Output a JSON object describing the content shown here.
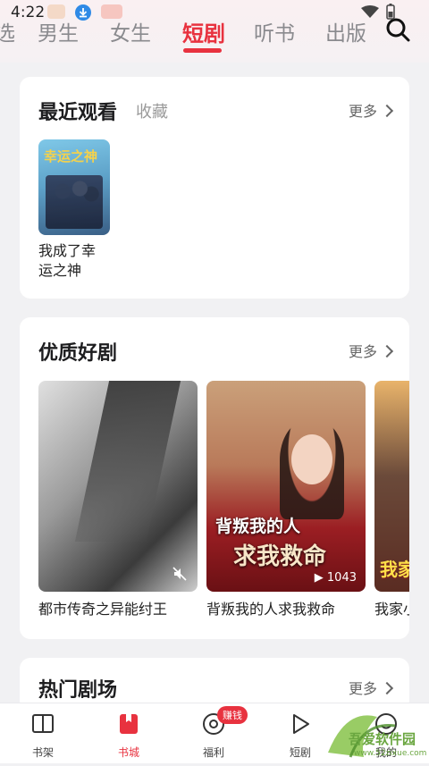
{
  "status_bar": {
    "time": "4:22"
  },
  "tabs": [
    {
      "label": "选"
    },
    {
      "label": "男生"
    },
    {
      "label": "女生"
    },
    {
      "label": "短剧",
      "active": true
    },
    {
      "label": "听书"
    },
    {
      "label": "出版"
    }
  ],
  "recent": {
    "title": "最近观看",
    "subtitle": "收藏",
    "more": "更多",
    "items": [
      {
        "title": "我成了幸运之神",
        "line1": "我成了幸",
        "line2": "运之神",
        "poster_text": "幸运之神"
      }
    ]
  },
  "quality": {
    "title": "优质好剧",
    "more": "更多",
    "items": [
      {
        "title": "都市传奇之异能纣王"
      },
      {
        "title": "背叛我的人求我救命",
        "overlay1": "背叛我的人",
        "overlay2": "求我救命",
        "play_count": "1043"
      },
      {
        "title": "我家小",
        "overlay": "我家"
      }
    ]
  },
  "theater": {
    "title": "热门剧场",
    "more": "更多"
  },
  "bottom_nav": [
    {
      "label": "书架",
      "icon": "book-open-icon"
    },
    {
      "label": "书城",
      "icon": "bookmark-icon",
      "active": true
    },
    {
      "label": "福利",
      "icon": "coin-icon",
      "badge": "赚钱"
    },
    {
      "label": "短剧",
      "icon": "play-icon"
    },
    {
      "label": "我的",
      "icon": "smile-icon"
    }
  ],
  "watermark": {
    "line1": "吾爱软件园",
    "line2": "www.52zixue.com"
  },
  "colors": {
    "accent": "#e8323f",
    "background": "#f1f1f3",
    "card": "#ffffff"
  }
}
